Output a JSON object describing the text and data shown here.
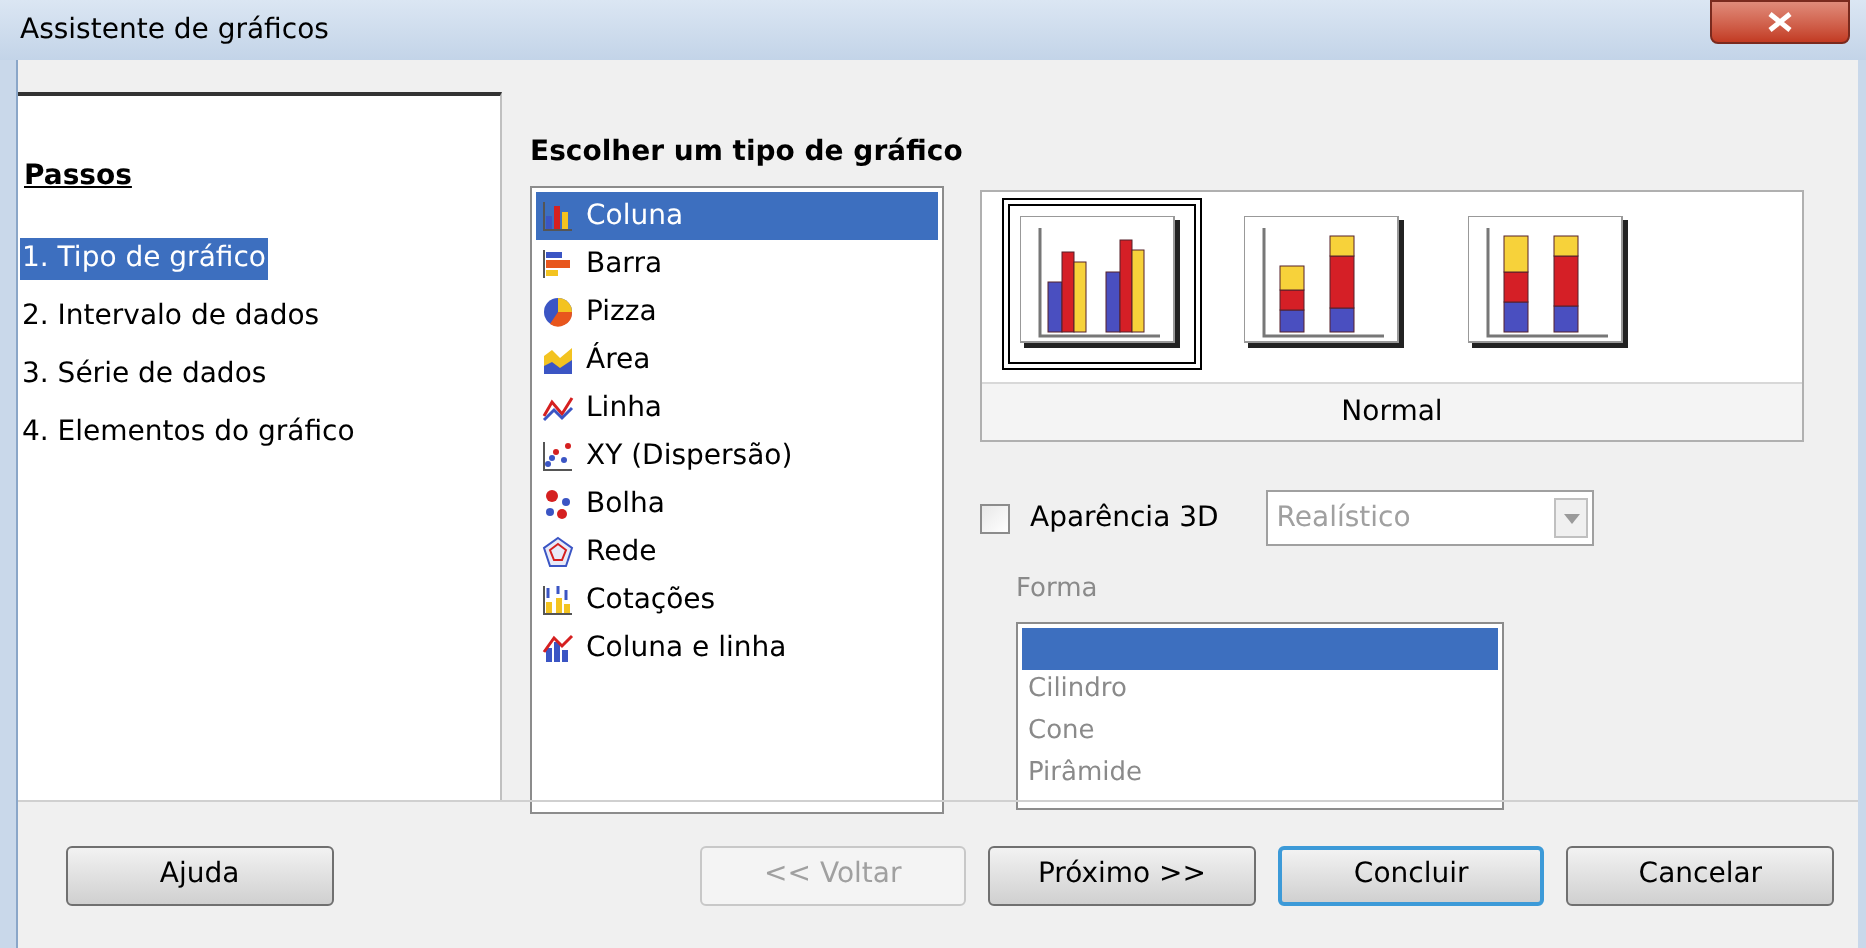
{
  "window": {
    "title": "Assistente de gráficos"
  },
  "steps": {
    "heading": "Passos",
    "items": [
      {
        "label": "1. Tipo de gráfico",
        "selected": true
      },
      {
        "label": "2. Intervalo de dados",
        "selected": false
      },
      {
        "label": "3. Série de dados",
        "selected": false
      },
      {
        "label": "4. Elementos do gráfico",
        "selected": false
      }
    ]
  },
  "chart_types": {
    "heading": "Escolher um tipo de gráfico",
    "items": [
      {
        "label": "Coluna",
        "kind": "column",
        "selected": true
      },
      {
        "label": "Barra",
        "kind": "bar",
        "selected": false
      },
      {
        "label": "Pizza",
        "kind": "pie",
        "selected": false
      },
      {
        "label": "Área",
        "kind": "area",
        "selected": false
      },
      {
        "label": "Linha",
        "kind": "line",
        "selected": false
      },
      {
        "label": "XY (Dispersão)",
        "kind": "scatter",
        "selected": false
      },
      {
        "label": "Bolha",
        "kind": "bubble",
        "selected": false
      },
      {
        "label": "Rede",
        "kind": "net",
        "selected": false
      },
      {
        "label": "Cotações",
        "kind": "stock",
        "selected": false
      },
      {
        "label": "Coluna e linha",
        "kind": "columnline",
        "selected": false
      }
    ]
  },
  "variants": {
    "items": [
      {
        "kind": "normal",
        "selected": true
      },
      {
        "kind": "stacked",
        "selected": false
      },
      {
        "kind": "percent",
        "selected": false
      }
    ],
    "caption": "Normal"
  },
  "appearance_3d": {
    "label": "Aparência 3D",
    "checked": false,
    "dropdown": {
      "value": "Realístico",
      "disabled": true
    }
  },
  "shape": {
    "label": "Forma",
    "disabled": true,
    "items": [
      {
        "selected": true
      },
      {
        "label": "Cilindro",
        "selected": false
      },
      {
        "label": "Cone",
        "selected": false
      },
      {
        "label": "Pirâmide",
        "selected": false
      }
    ]
  },
  "buttons": [
    {
      "label": "Ajuda",
      "disabled": false,
      "default": false
    },
    {
      "label": "<< Voltar",
      "disabled": true,
      "default": false
    },
    {
      "label": "Próximo >>",
      "disabled": false,
      "default": false
    },
    {
      "label": "Concluir",
      "disabled": false,
      "default": true
    },
    {
      "label": "Cancelar",
      "disabled": false,
      "default": false
    }
  ]
}
